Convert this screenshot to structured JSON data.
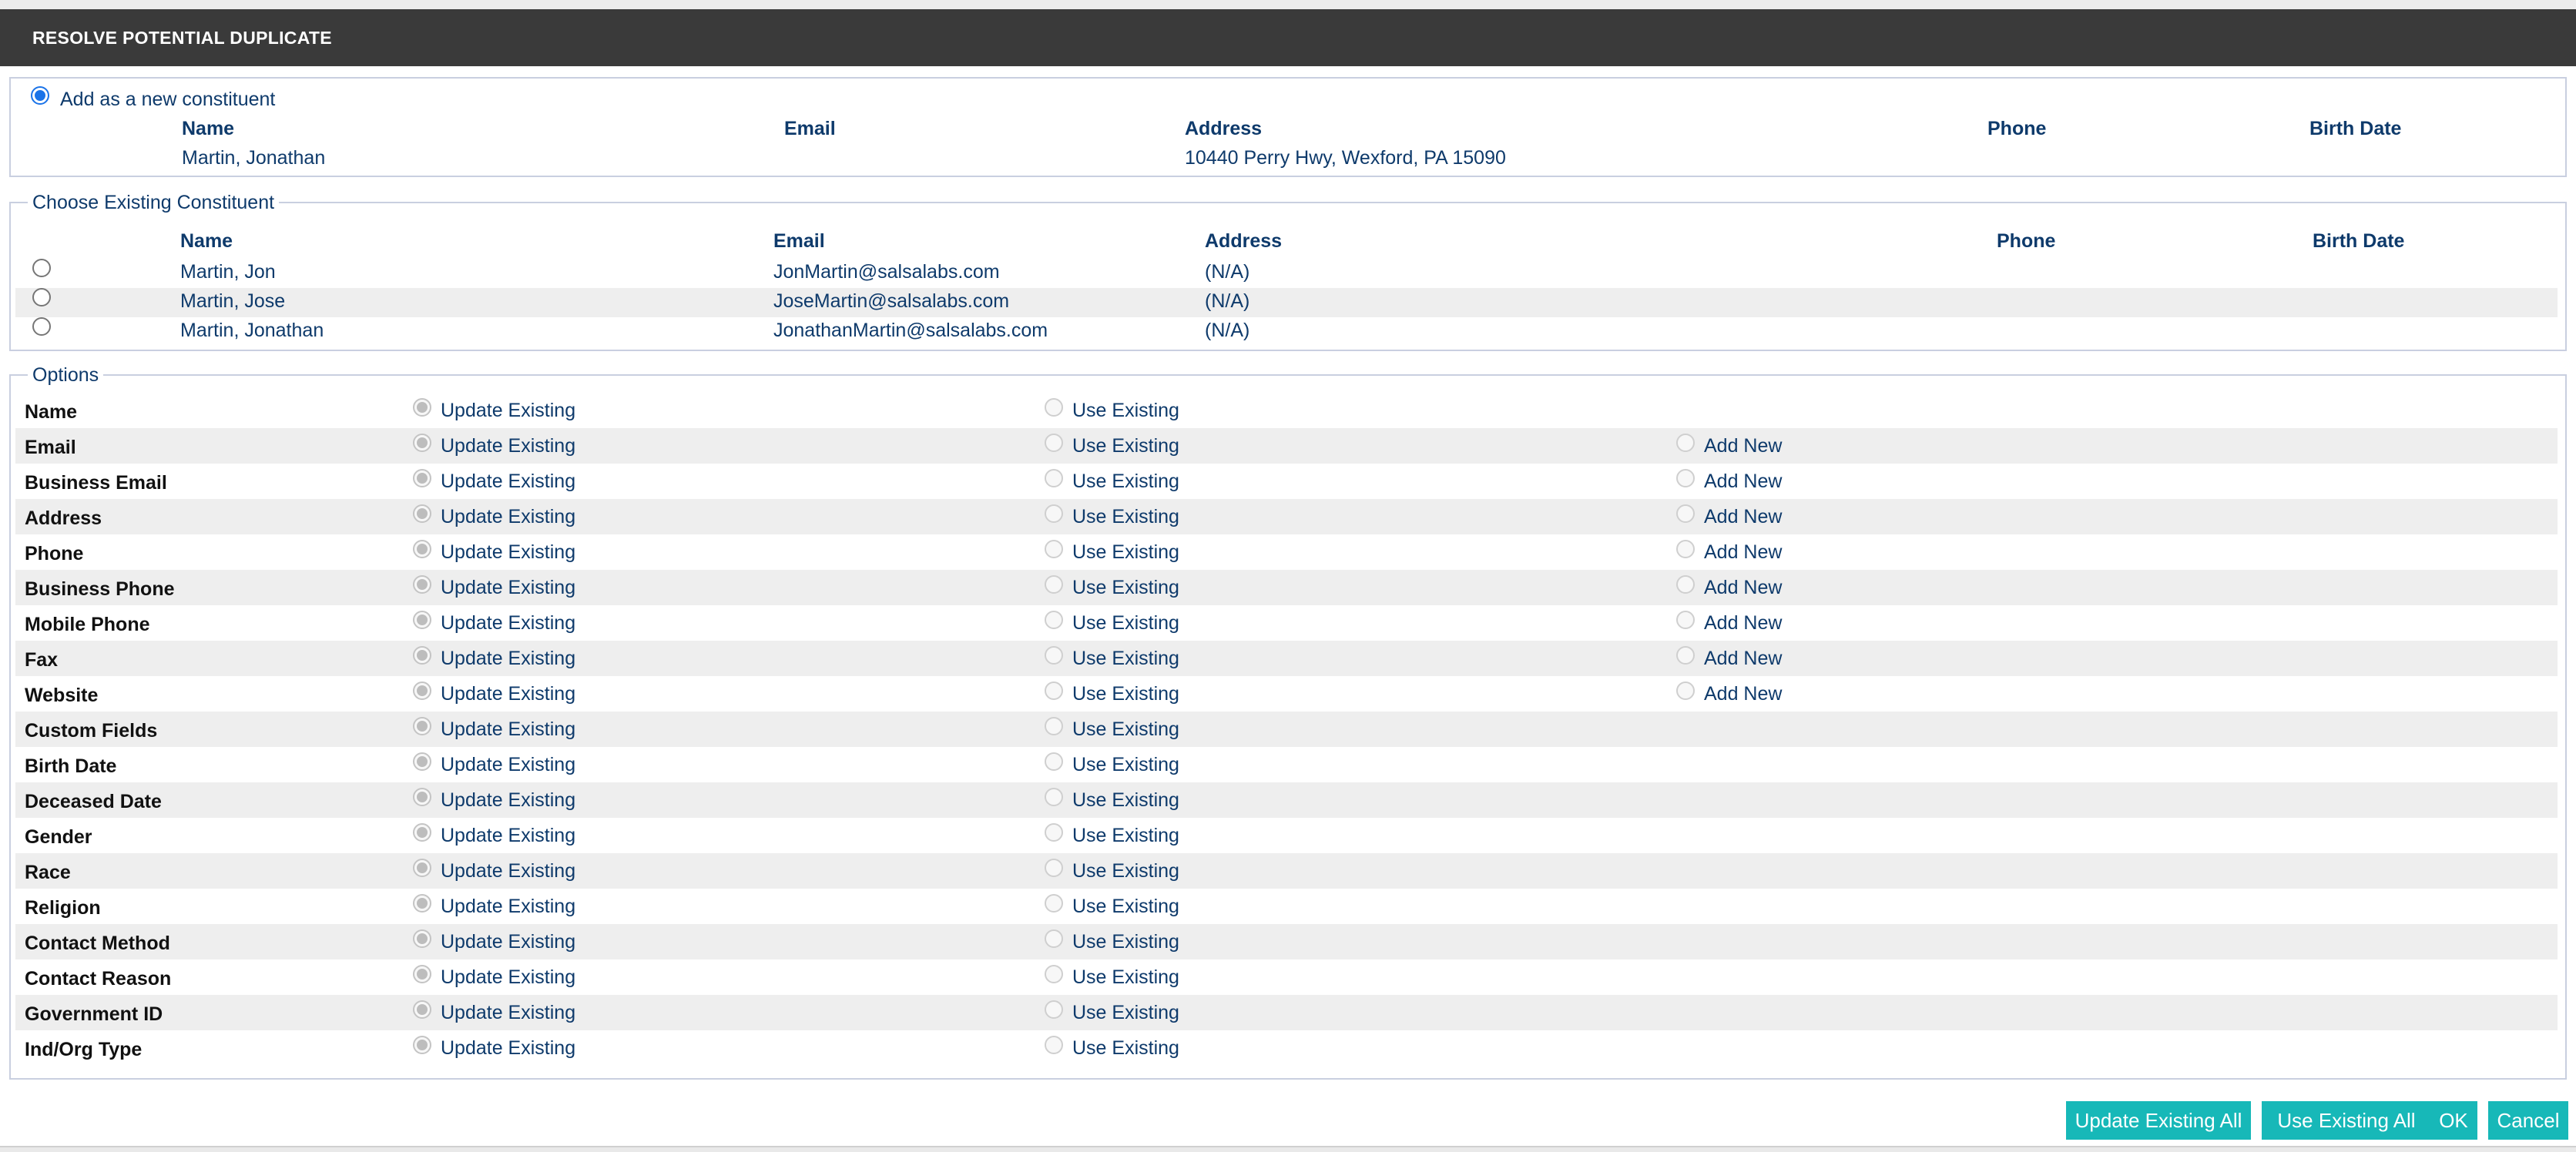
{
  "dialog": {
    "title": "RESOLVE POTENTIAL DUPLICATE"
  },
  "new_constituent": {
    "option_label": "Add as a new constituent",
    "selected": true,
    "columns": [
      "Name",
      "Email",
      "Address",
      "Phone",
      "Birth Date"
    ],
    "row": {
      "name": "Martin, Jonathan",
      "email": "",
      "address": "10440 Perry Hwy, Wexford, PA 15090",
      "phone": "",
      "birth_date": ""
    }
  },
  "existing": {
    "legend": "Choose Existing Constituent",
    "columns": [
      "Name",
      "Email",
      "Address",
      "Phone",
      "Birth Date"
    ],
    "rows": [
      {
        "name": "Martin, Jon",
        "email": "JonMartin@salsalabs.com",
        "address": "(N/A)"
      },
      {
        "name": "Martin, Jose",
        "email": "JoseMartin@salsalabs.com",
        "address": "(N/A)"
      },
      {
        "name": "Martin, Jonathan",
        "email": "JonathanMartin@salsalabs.com",
        "address": "(N/A)"
      }
    ]
  },
  "options": {
    "legend": "Options",
    "choice_labels": {
      "update": "Update Existing",
      "use": "Use Existing",
      "add": "Add New"
    },
    "rows": [
      {
        "label": "Name",
        "add_new": false
      },
      {
        "label": "Email",
        "add_new": true
      },
      {
        "label": "Business Email",
        "add_new": true
      },
      {
        "label": "Address",
        "add_new": true
      },
      {
        "label": "Phone",
        "add_new": true
      },
      {
        "label": "Business Phone",
        "add_new": true
      },
      {
        "label": "Mobile Phone",
        "add_new": true
      },
      {
        "label": "Fax",
        "add_new": true
      },
      {
        "label": "Website",
        "add_new": true
      },
      {
        "label": "Custom Fields",
        "add_new": false
      },
      {
        "label": "Birth Date",
        "add_new": false
      },
      {
        "label": "Deceased Date",
        "add_new": false
      },
      {
        "label": "Gender",
        "add_new": false
      },
      {
        "label": "Race",
        "add_new": false
      },
      {
        "label": "Religion",
        "add_new": false
      },
      {
        "label": "Contact Method",
        "add_new": false
      },
      {
        "label": "Contact Reason",
        "add_new": false
      },
      {
        "label": "Government ID",
        "add_new": false
      },
      {
        "label": "Ind/Org Type",
        "add_new": false
      }
    ]
  },
  "buttons": {
    "update_existing_all": "Update Existing All",
    "use_existing_all": "Use Existing All",
    "ok": "OK",
    "cancel": "Cancel"
  },
  "colors": {
    "title_bar": "#3a3a3a",
    "accent_button": "#17b8b8",
    "text": "#0e3a6b",
    "radio_selected": "#1a73e8"
  }
}
